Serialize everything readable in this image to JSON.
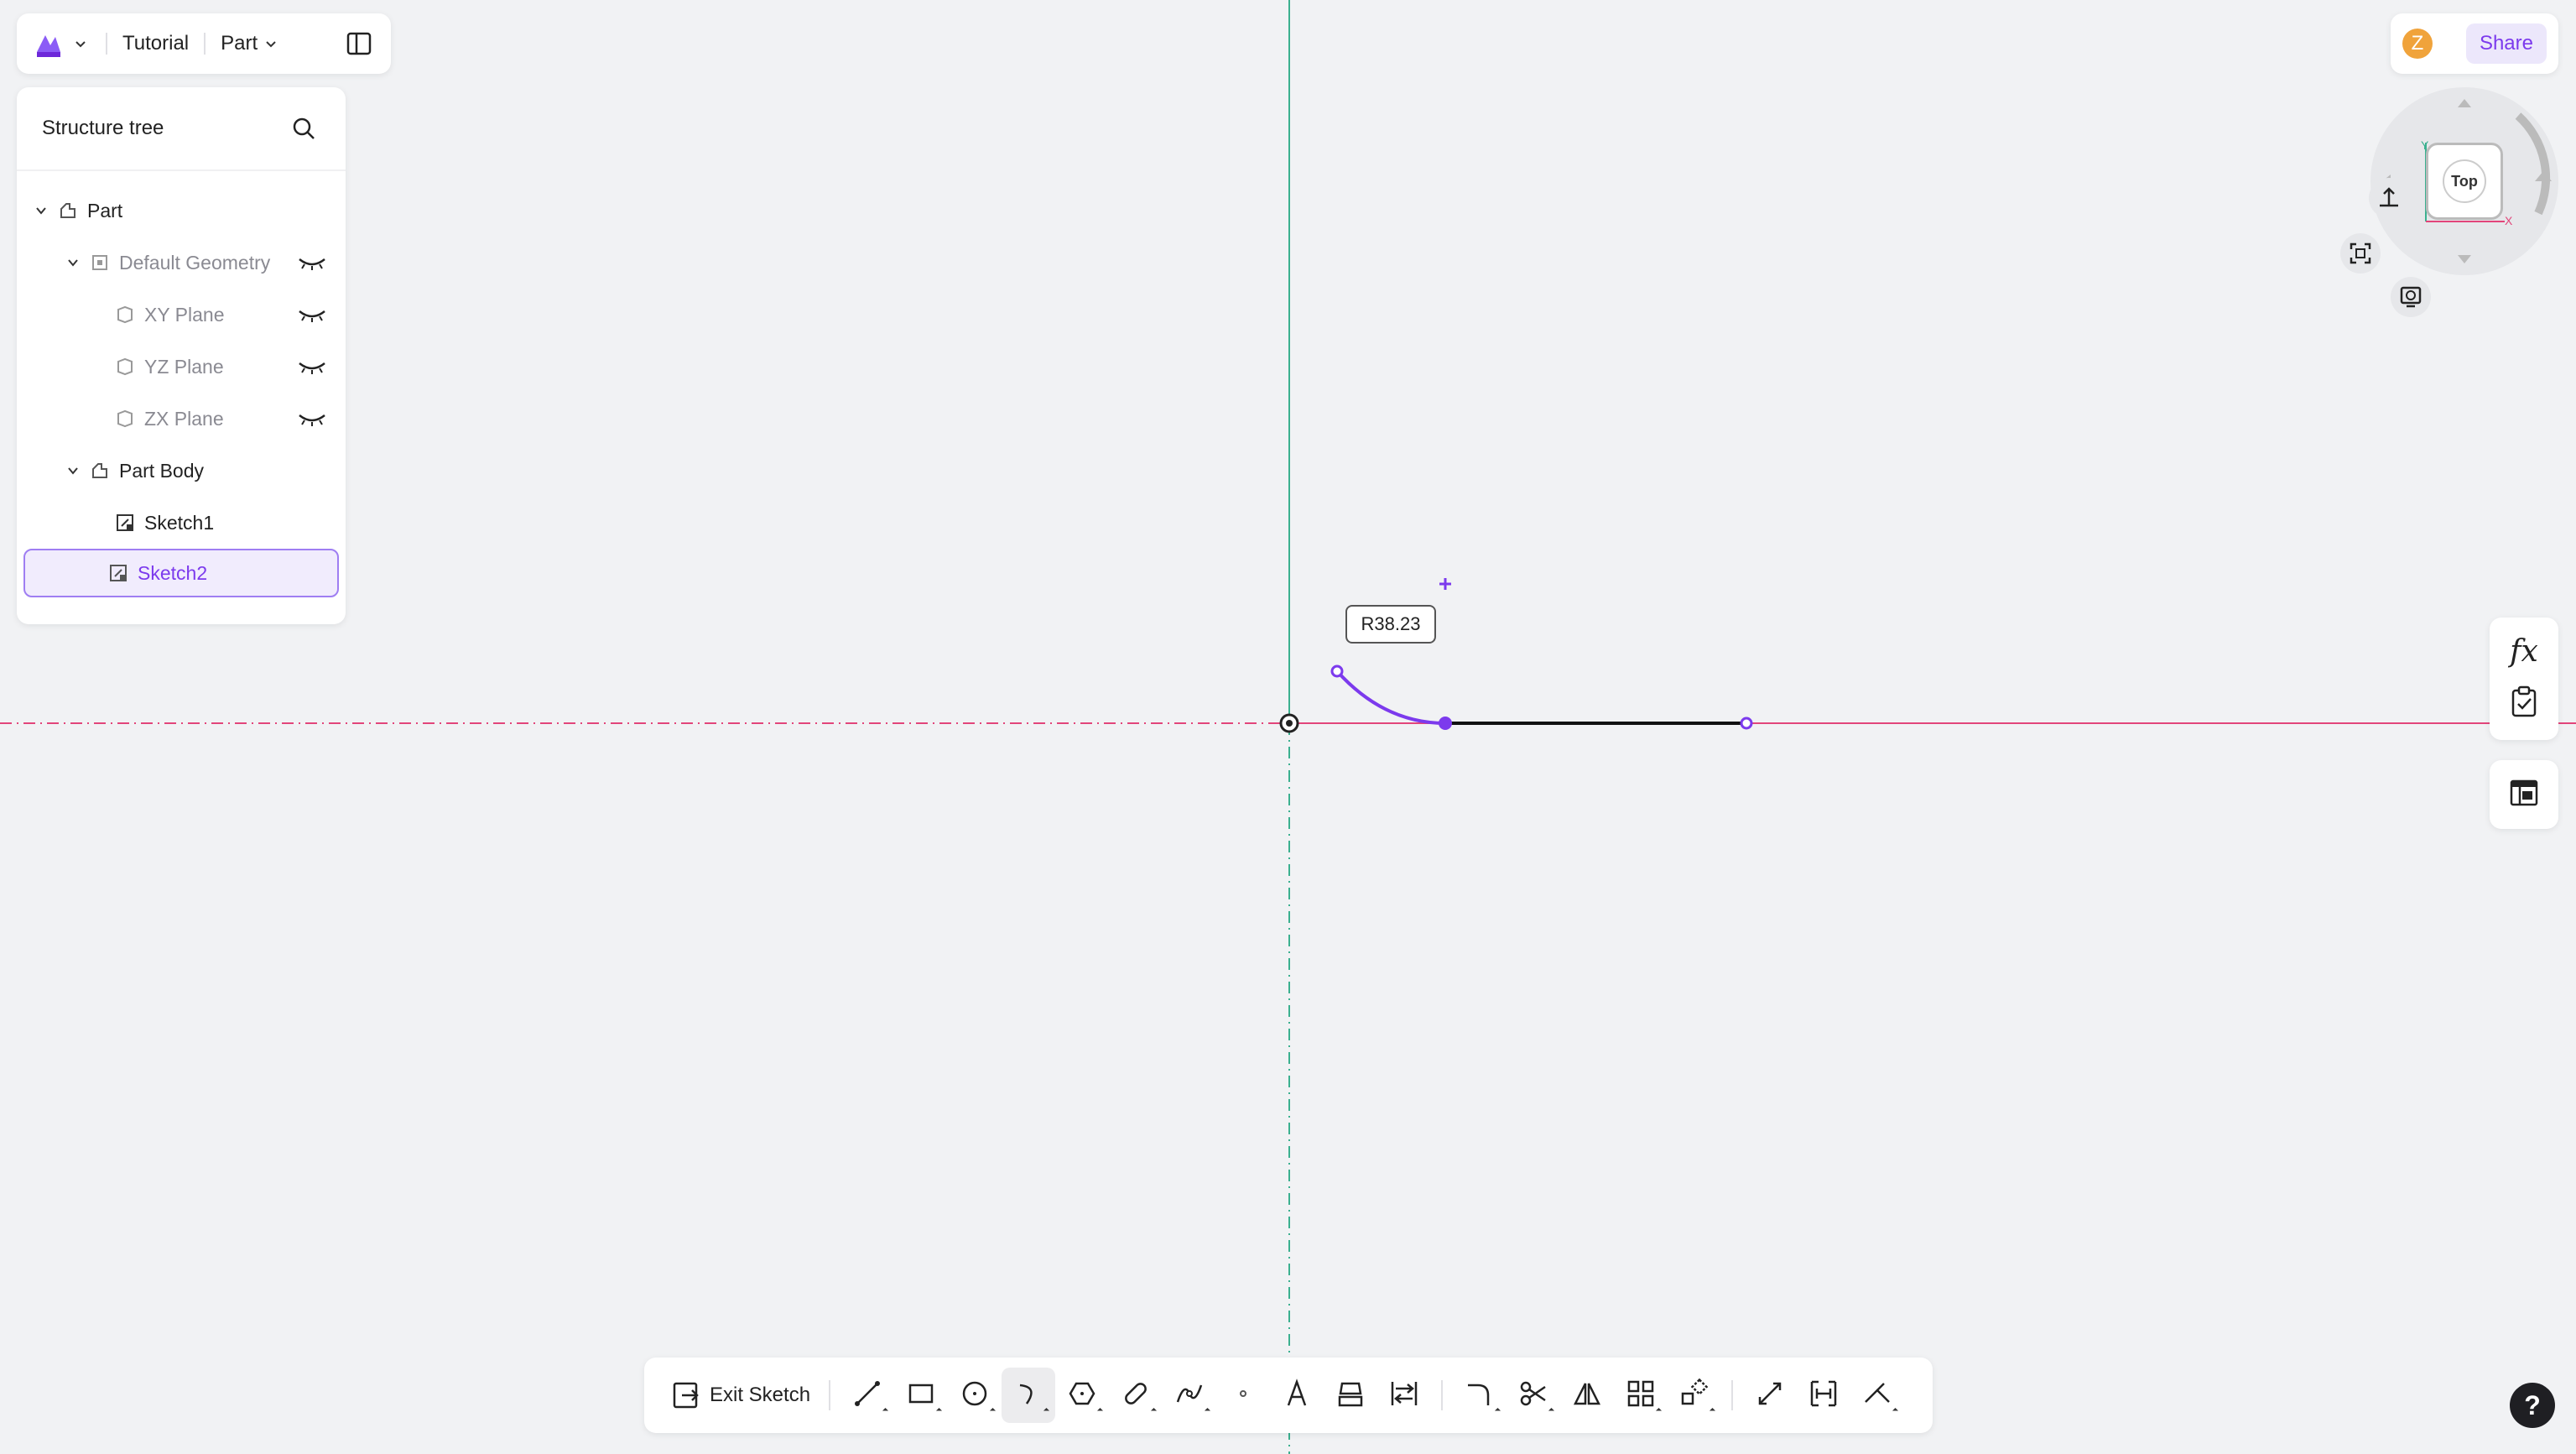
{
  "topbar": {
    "project_label": "Tutorial",
    "mode_label": "Part"
  },
  "tree": {
    "title": "Structure tree",
    "items": [
      {
        "label": "Part"
      },
      {
        "label": "Default Geometry"
      },
      {
        "label": "XY Plane"
      },
      {
        "label": "YZ Plane"
      },
      {
        "label": "ZX Plane"
      },
      {
        "label": "Part Body"
      },
      {
        "label": "Sketch1"
      },
      {
        "label": "Sketch2"
      }
    ]
  },
  "user": {
    "avatar_letter": "Z",
    "share_label": "Share"
  },
  "navcube": {
    "face_label": "Top",
    "axis_y": "Y",
    "axis_x": "X"
  },
  "sketch": {
    "dimension_label": "R38.23"
  },
  "toolbar": {
    "exit_label": "Exit Sketch"
  },
  "help": {
    "label": "?"
  },
  "colors": {
    "accent": "#7c3aed",
    "x_axis": "#e2457a",
    "y_axis": "#3bb08f"
  },
  "icons": [
    "logo-icon",
    "chevron-down-icon",
    "panel-toggle-icon",
    "search-icon",
    "part-icon",
    "geometry-icon",
    "plane-icon",
    "eye-closed-icon",
    "body-icon",
    "sketch-icon",
    "fx-icon",
    "checklist-icon",
    "table-icon",
    "help-icon"
  ]
}
